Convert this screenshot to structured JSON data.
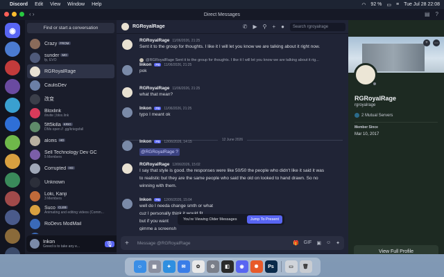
{
  "menubar": {
    "apple": "",
    "app": "Discord",
    "items": [
      "Edit",
      "View",
      "Window",
      "Help"
    ],
    "battery": "92 %",
    "datetime": "Tue Jul 28  22:08"
  },
  "window": {
    "title": "Direct Messages"
  },
  "dm_sidebar": {
    "search_placeholder": "Find or start a conversation",
    "items": [
      {
        "name": "Crazy",
        "tag": "FROM",
        "sub": "",
        "color": "#8a6b5a"
      },
      {
        "name": "sunder",
        "tag": "MO",
        "sub": "fp, EVO",
        "color": "#4f5a7a"
      },
      {
        "name": "RGRoyalRage",
        "tag": "",
        "sub": "",
        "color": "#e8e1d2"
      },
      {
        "name": "CaulisDev",
        "tag": "",
        "sub": "",
        "color": "#6b7fa6"
      },
      {
        "name": "改变",
        "tag": "",
        "sub": "",
        "color": "#3b3f4a"
      },
      {
        "name": "Bloxlink",
        "tag": "",
        "sub": "/invite | blox.link",
        "color": "#d93b5b"
      },
      {
        "name": "5ft5killa",
        "tag": "KRIG",
        "sub": "DMs open // .gg/kriegsfall",
        "color": "#5f8a6a"
      },
      {
        "name": "alceis",
        "tag": "HD",
        "sub": "",
        "color": "#b8b0a0"
      },
      {
        "name": "Sell Technology Dev GC",
        "tag": "",
        "sub": "5 Members",
        "color": "#7b5ea8"
      },
      {
        "name": "Corrupted",
        "tag": "HD",
        "sub": "",
        "color": "#a0a8b8"
      },
      {
        "name": "Unknown",
        "tag": "",
        "sub": "",
        "color": "#2c2f3a"
      },
      {
        "name": "Loki, Kanji",
        "tag": "",
        "sub": "3 Members",
        "color": "#c06a3a"
      },
      {
        "name": "Suco",
        "tag": "CLEB",
        "sub": "Animating and editing videos (Comm...",
        "color": "#d8a040"
      },
      {
        "name": "RoDevs ModMail",
        "tag": "",
        "sub": "",
        "color": "#3a6ab8"
      },
      {
        "name": "RoDevs Mod Team",
        "tag": "",
        "sub": "",
        "color": "#3a6ab8"
      }
    ]
  },
  "user_panel": {
    "name": "Inkon",
    "status": "Greed is to take any e..."
  },
  "chat": {
    "header_name": "RGRoyalRage",
    "search_placeholder": "Search rgroyalrage",
    "day_divider": "12 June 2026",
    "messages": [
      {
        "author": "RGRoyalRage",
        "time": "11/06/2026, 21:25",
        "badge": "",
        "reply": "",
        "lines": [
          "Sent it to the group for thoughts. I like it I will let you know we are talking about it right now."
        ],
        "color": "#e8e1d2"
      },
      {
        "author": "Inkon",
        "time": "11/06/2026, 21:25",
        "badge": "PB",
        "reply": "@RGRoyalRage Sent it to the group for thoughts. I like it I will let you know we are talking about it rig...",
        "lines": [
          "pok"
        ],
        "color": "#7a8aa8"
      },
      {
        "author": "RGRoyalRage",
        "time": "11/06/2026, 21:25",
        "badge": "",
        "reply": "",
        "lines": [
          "what that mean?"
        ],
        "color": "#e8e1d2"
      },
      {
        "author": "Inkon",
        "time": "11/06/2026, 21:25",
        "badge": "PB",
        "reply": "",
        "lines": [
          "typo I meant ok"
        ],
        "color": "#7a8aa8"
      },
      {
        "author": "Inkon",
        "time": "12/06/2026, 14:15",
        "badge": "PB",
        "reply": "",
        "lines": [
          "@RGRoyalRage ?"
        ],
        "color": "#7a8aa8"
      },
      {
        "author": "RGRoyalRage",
        "time": "12/06/2026, 15:02",
        "badge": "",
        "reply": "",
        "lines": [
          "I say that style is good. the responses were like 50/50 the people who didn't like it said it was",
          "to realistic but they are the same people who said the old on looked to hand drawn. So no",
          "winning with them."
        ],
        "color": "#e8e1d2"
      },
      {
        "author": "Inkon",
        "time": "12/06/2026, 15:04",
        "badge": "PB",
        "reply": "",
        "lines": [
          "well do I needa change smth or what",
          "cuz I personally think it would fit",
          "but if you want",
          "gimme a screensh",
          "and ill overlay my stuff"
        ],
        "color": "#7a8aa8"
      }
    ],
    "older_notice": "You're Viewing Older Messages",
    "jump_label": "Jump To Present",
    "composer_placeholder": "Message @RGRoyalRage"
  },
  "profile": {
    "display_name": "RGRoyalRage",
    "username": "rgroyalrage",
    "mutual_servers": "2 Mutual Servers",
    "member_since_label": "Member Since",
    "member_since": "Mar 10, 2017",
    "view_full_label": "View Full Profile"
  },
  "dock": {
    "apps": [
      {
        "name": "finder",
        "glyph": "☺",
        "color": "#3a8ee6"
      },
      {
        "name": "launchpad",
        "glyph": "▦",
        "color": "#8a8fa0"
      },
      {
        "name": "safari",
        "glyph": "✦",
        "color": "#2f8fe0"
      },
      {
        "name": "mail",
        "glyph": "✉",
        "color": "#3a7de8"
      },
      {
        "name": "chatgpt",
        "glyph": "✿",
        "color": "#e8e8e8"
      },
      {
        "name": "settings",
        "glyph": "⚙",
        "color": "#7a7f8a"
      },
      {
        "name": "roblox",
        "glyph": "◧",
        "color": "#2a2a2a"
      },
      {
        "name": "discord",
        "glyph": "◉",
        "color": "#5865f2"
      },
      {
        "name": "copilot",
        "glyph": "✺",
        "color": "#e85a2a"
      },
      {
        "name": "photoshop",
        "glyph": "Ps",
        "color": "#0a2a4a"
      },
      {
        "name": "preview",
        "glyph": "▭",
        "color": "#d0d4da"
      },
      {
        "name": "trash",
        "glyph": "🗑",
        "color": "#c8ccd2"
      }
    ]
  }
}
